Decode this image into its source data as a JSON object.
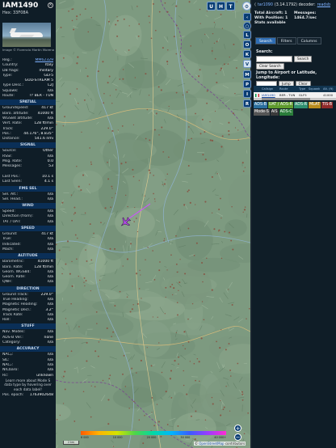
{
  "aircraft": {
    "callsign": "IAM1490",
    "hex": "Hex: 33F08A",
    "photo_credit": "Image © Florencio Martin Moreno"
  },
  "left_rows": [
    {
      "k": "Reg.:",
      "v": "MM62329",
      "link": true
    },
    {
      "k": "Country:",
      "v": "Italy"
    },
    {
      "k": "DB flags:",
      "v": "military"
    },
    {
      "k": "Type:",
      "v": "GLF5"
    },
    {
      "k": "",
      "v": "GULFSTREAM 5"
    },
    {
      "k": "Type Desc.:",
      "v": "L2J"
    },
    {
      "k": "Squawk:",
      "v": "n/a"
    },
    {
      "k": "Route:",
      "v": "?? BER - TUN"
    }
  ],
  "sections": [
    {
      "title": "SPATIAL",
      "rows": [
        {
          "k": "Groundspeed:",
          "v": "417 kt"
        },
        {
          "k": "Baro. altitude:",
          "v": "41000 ft"
        },
        {
          "k": "WGS84 altitude:",
          "v": "n/a"
        },
        {
          "k": "Vert. Rate:",
          "v": "128 ft/min"
        },
        {
          "k": "Track:",
          "v": "229.0°"
        },
        {
          "k": "Pos.:",
          "v": "44.176°, 8.835°"
        },
        {
          "k": "Distance:",
          "v": "541.6 nmi"
        }
      ]
    },
    {
      "title": "SIGNAL",
      "rows": [
        {
          "k": "Source:",
          "v": "Other"
        },
        {
          "k": "RSSI:",
          "v": "n/a"
        },
        {
          "k": "Msg. Rate:",
          "v": "0.0"
        },
        {
          "k": "Messages:",
          "v": "53"
        },
        {
          "k": "",
          "v": ""
        },
        {
          "k": "Last Pos.:",
          "v": "10.1 s"
        },
        {
          "k": "Last Seen:",
          "v": "4.1 s"
        }
      ]
    },
    {
      "title": "FMS SEL",
      "rows": [
        {
          "k": "Sel. Alt.:",
          "v": "n/a"
        },
        {
          "k": "Sel. Head.:",
          "v": "n/a"
        }
      ]
    },
    {
      "title": "WIND",
      "rows": [
        {
          "k": "Speed:",
          "v": "n/a"
        },
        {
          "k": "Direction (from):",
          "v": "n/a"
        },
        {
          "k": "TAT / OAT:",
          "v": "n/a"
        }
      ]
    },
    {
      "title": "SPEED",
      "rows": [
        {
          "k": "Ground:",
          "v": "417 kt"
        },
        {
          "k": "True:",
          "v": "n/a"
        },
        {
          "k": "Indicated:",
          "v": "n/a"
        },
        {
          "k": "Mach:",
          "v": "n/a"
        }
      ]
    },
    {
      "title": "ALTITUDE",
      "rows": [
        {
          "k": "Barometric:",
          "v": "41000 ft"
        },
        {
          "k": "Baro. Rate:",
          "v": "128 ft/min"
        },
        {
          "k": "Geom. WGS84:",
          "v": "n/a"
        },
        {
          "k": "Geom. Rate:",
          "v": "n/a"
        },
        {
          "k": "QNH:",
          "v": "n/a"
        }
      ]
    },
    {
      "title": "DIRECTION",
      "rows": [
        {
          "k": "Ground Track:",
          "v": "229.0°"
        },
        {
          "k": "True Heading:",
          "v": "n/a"
        },
        {
          "k": "Magnetic Heading:",
          "v": "n/a"
        },
        {
          "k": "Magnetic Decl.:",
          "v": "3.2°"
        },
        {
          "k": "Track Rate:",
          "v": "n/a"
        },
        {
          "k": "Roll:",
          "v": "n/a"
        }
      ]
    },
    {
      "title": "STUFF",
      "rows": [
        {
          "k": "Nav. Modes:",
          "v": "n/a"
        },
        {
          "k": "ADS-B Ver.:",
          "v": "none"
        },
        {
          "k": "Category:",
          "v": "n/a"
        }
      ]
    },
    {
      "title": "ACCURACY",
      "rows": [
        {
          "k": "NACₚ:",
          "v": "n/a"
        },
        {
          "k": "SIL:",
          "v": "n/a"
        },
        {
          "k": "NACᵥ:",
          "v": "n/a"
        },
        {
          "k": "NICbaro:",
          "v": "n/a"
        },
        {
          "k": "Rc:",
          "v": "unknown"
        }
      ]
    }
  ],
  "left_note": "Learn more about Mode S data type by hovering over each data label!",
  "left_footer": {
    "k": "Pos. epoch:",
    "v": "1763902648"
  },
  "map_buttons": [
    "U",
    "H",
    "T"
  ],
  "side_buttons": [
    "L",
    "O",
    "K",
    "M",
    "P",
    "I",
    "R"
  ],
  "side_light_buttons": [
    "V"
  ],
  "zoom_in": "+",
  "zoom_out": "−",
  "alt_labels": [
    "6 000",
    "10 000",
    "20 000",
    "30 000",
    "40 000+"
  ],
  "scale_label": "2 km",
  "attribution": {
    "prefix": "© ",
    "link": "OpenStreetMap",
    "suffix": " contributors"
  },
  "colors": {
    "aircraft": "#b14ee5",
    "track": "#c65bf2",
    "map_bg": "#7d9a80",
    "panel_bg": "#0f1d27"
  },
  "right": {
    "project": "tar1090",
    "version": "(3.14.1792) decoder:",
    "decoder": "readsb",
    "total": "Total Aircraft: 1",
    "messages_label": "Messages:",
    "messages_value": "1464.7/sec",
    "with_pos": "With Position: 1",
    "stats": "Stats available",
    "tabs": [
      "Search",
      "Filters",
      "Columns"
    ],
    "search_label": "Search:",
    "search_button": "Search",
    "clear_search": "Clear Search",
    "jump_label": "Jump to Airport or Latitude, Longitude:",
    "jump_button": "Jump",
    "clear_button": "Clear",
    "columns": [
      "",
      "Callsign",
      "Route",
      "Type",
      "Squawk",
      "Alt. (ft)"
    ],
    "rows": [
      {
        "hex": "IAM1490",
        "route": "BER - TUN",
        "type": "GLF5",
        "squawk": "",
        "alt": "41000"
      }
    ],
    "badges": [
      {
        "label": "ADS-B",
        "color": "#2b6f9e"
      },
      {
        "label": "UAT / ADS-R",
        "color": "#5f9b2e"
      },
      {
        "label": "ADS-R",
        "color": "#2f8f6f"
      },
      {
        "label": "MLAT",
        "color": "#b88b1d"
      },
      {
        "label": "TIS-B",
        "color": "#8f2a2a"
      },
      {
        "label": "Mode-S",
        "color": "#555555"
      },
      {
        "label": "AIS",
        "color": "#3b3b3b"
      },
      {
        "label": "ADS-C",
        "color": "#2a7d3a"
      }
    ]
  }
}
